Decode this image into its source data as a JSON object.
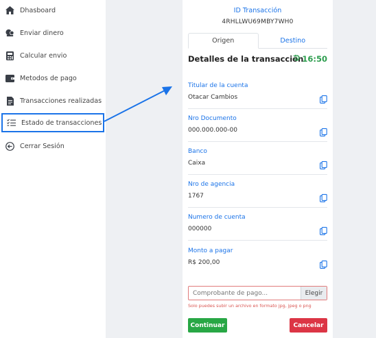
{
  "sidebar": {
    "items": [
      {
        "label": "Dhasboard",
        "icon": "home-icon"
      },
      {
        "label": "Enviar dinero",
        "icon": "money-transfer-icon"
      },
      {
        "label": "Calcular envio",
        "icon": "calculator-icon"
      },
      {
        "label": "Metodos de pago",
        "icon": "wallet-icon"
      },
      {
        "label": "Transacciones realizadas",
        "icon": "document-icon"
      },
      {
        "label": "Estado de transacciones",
        "icon": "checklist-icon",
        "active": true
      },
      {
        "label": "Cerrar Sesión",
        "icon": "logout-icon"
      }
    ]
  },
  "transaction": {
    "id_label": "ID Transacción",
    "id_value": "4RHLLWU69MBY7WH0"
  },
  "tabs": {
    "origin": "Origen",
    "destination": "Destino"
  },
  "details": {
    "title": "Detalles de la transaccion",
    "time": "16:50"
  },
  "fields": [
    {
      "label": "Titular de la cuenta",
      "value": "Otacar Cambios"
    },
    {
      "label": "Nro Documento",
      "value": "000.000.000-00"
    },
    {
      "label": "Banco",
      "value": "Caixa"
    },
    {
      "label": "Nro de agencia",
      "value": "1767"
    },
    {
      "label": "Numero de cuenta",
      "value": "000000"
    },
    {
      "label": "Monto a pagar",
      "value": "R$ 200,00"
    }
  ],
  "upload": {
    "placeholder": "Comprobante de pago...",
    "button": "Elegir",
    "hint": "Solo puedes subir un archivo en formato jpg, jpeg o png"
  },
  "actions": {
    "continue": "Continuar",
    "cancel": "Cancelar"
  },
  "colors": {
    "accent": "#1a73e8",
    "success": "#28a745",
    "danger": "#dc3545",
    "time": "#2e9e4f"
  }
}
